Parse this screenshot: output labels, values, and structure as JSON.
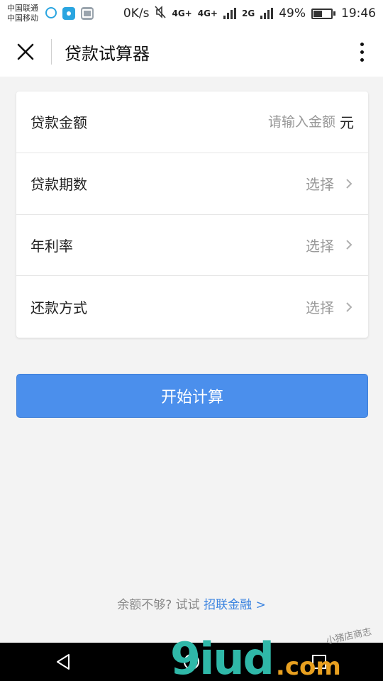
{
  "status_bar": {
    "carrier_1": "中国联通",
    "carrier_2": "中国移动",
    "speed": "0K/s",
    "net_1": "4G+",
    "net_2": "4G+",
    "net_3": "2G",
    "battery_percent": "49%",
    "battery_level": 0.49,
    "time": "19:46"
  },
  "header": {
    "title": "贷款试算器"
  },
  "form": {
    "amount": {
      "label": "贷款金额",
      "placeholder": "请输入金额",
      "unit": "元"
    },
    "term": {
      "label": "贷款期数",
      "value": "选择"
    },
    "rate": {
      "label": "年利率",
      "value": "选择"
    },
    "method": {
      "label": "还款方式",
      "value": "选择"
    }
  },
  "actions": {
    "calculate_label": "开始计算"
  },
  "footer": {
    "prefix": "余额不够? 试试 ",
    "link": "招联金融 >"
  },
  "watermark": {
    "main": "9iud",
    "suffix": ".com",
    "small": "小猪店商志"
  },
  "colors": {
    "accent": "#4b8fec",
    "link": "#3a83e0",
    "background": "#f3f3f3"
  }
}
